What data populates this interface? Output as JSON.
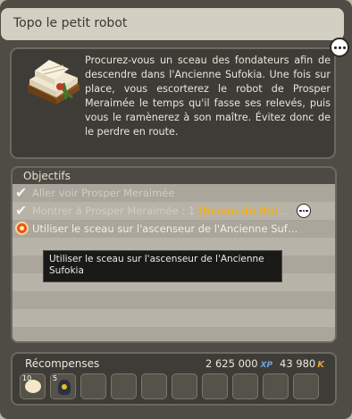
{
  "window": {
    "title": "Topo le petit robot"
  },
  "quest": {
    "description": "Procurez-vous un sceau des fondateurs afin de descendre dans l'Ancienne Sufokia. Une fois sur place, vous escorterez le robot de Prosper Meraimée le temps qu'il fasse ses relevés, puis vous le ramènerez à son maître. Évitez donc de le perdre en route.",
    "image_icon": "book-with-seal-icon"
  },
  "objectives": {
    "header": "Objectifs",
    "items": [
      {
        "text": "Aller voir Prosper Meraimée",
        "state": "done",
        "icon": "checkmark-icon"
      },
      {
        "text": "Montrer à Prosper Meraimée : 1 ",
        "item": "[Sceau du Roi",
        "suffix": "…",
        "state": "done",
        "icon": "checkmark-icon"
      },
      {
        "text": "Utiliser le sceau sur l'ascenseur de l'Ancienne Suf…",
        "state": "active",
        "icon": "target-icon"
      }
    ],
    "tooltip": "Utiliser le sceau sur l'ascenseur de l'Ancienne Sufokia"
  },
  "rewards": {
    "label": "Récompenses",
    "xp": "2 625 000",
    "xp_unit": "XP",
    "kamas": "43 980",
    "kamas_unit": "K",
    "slots": [
      {
        "qty": "10",
        "icon": "bread-icon"
      },
      {
        "qty": "5",
        "icon": "creature-icon"
      },
      {},
      {},
      {},
      {},
      {},
      {},
      {},
      {},
      {}
    ]
  },
  "colors": {
    "item_highlight": "#f2b018",
    "xp": "#6fa2e6",
    "kamas": "#eaa03a"
  }
}
